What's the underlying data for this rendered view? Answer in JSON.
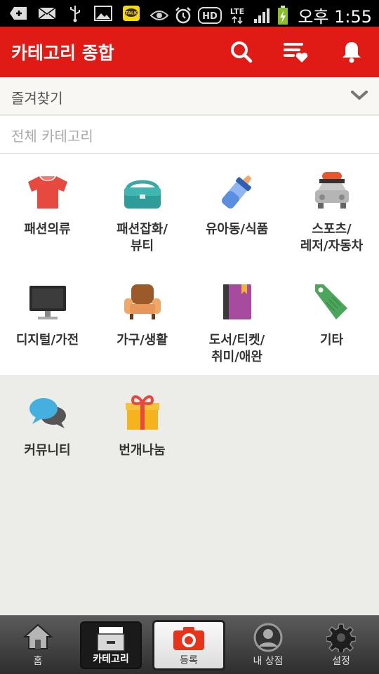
{
  "status_bar": {
    "time": "오후 1:55",
    "icons": [
      "add-icon",
      "mail-icon",
      "usb-icon",
      "image-icon",
      "kakaotalk-icon",
      "eye-icon",
      "alarm-icon",
      "hd-icon",
      "lte-icon",
      "signal-icon",
      "battery-icon"
    ],
    "kakao_label": "TALK",
    "hd_label": "HD",
    "lte_label": "LTE"
  },
  "header": {
    "title": "카테고리 종합",
    "accent": "#e01a14",
    "icons": [
      "search-icon",
      "wishlist-icon",
      "bell-icon"
    ]
  },
  "favorites": {
    "label": "즐겨찾기"
  },
  "all_categories": {
    "label": "전체 카테고리"
  },
  "categories": [
    {
      "label1": "패션의류",
      "label2": "",
      "icon": "tshirt-icon"
    },
    {
      "label1": "패션잡화/",
      "label2": "뷰티",
      "icon": "bag-icon"
    },
    {
      "label1": "유아동/식품",
      "label2": "",
      "icon": "baby-bottle-icon"
    },
    {
      "label1": "스포츠/",
      "label2": "레저/자동차",
      "icon": "car-icon"
    },
    {
      "label1": "디지털/가전",
      "label2": "",
      "icon": "monitor-icon"
    },
    {
      "label1": "가구/생활",
      "label2": "",
      "icon": "armchair-icon"
    },
    {
      "label1": "도서/티켓/",
      "label2": "취미/애완",
      "icon": "book-icon"
    },
    {
      "label1": "기타",
      "label2": "",
      "icon": "tag-icon"
    },
    {
      "label1": "커뮤니티",
      "label2": "",
      "icon": "chat-bubbles-icon"
    },
    {
      "label1": "번개나눔",
      "label2": "",
      "icon": "gift-icon"
    }
  ],
  "bottom_nav": [
    {
      "label": "홈",
      "icon": "home-icon"
    },
    {
      "label": "카테고리",
      "icon": "drawer-icon"
    },
    {
      "label": "등록",
      "icon": "camera-icon"
    },
    {
      "label": "내 상점",
      "icon": "profile-icon"
    },
    {
      "label": "설정",
      "icon": "settings-gear-icon"
    }
  ]
}
